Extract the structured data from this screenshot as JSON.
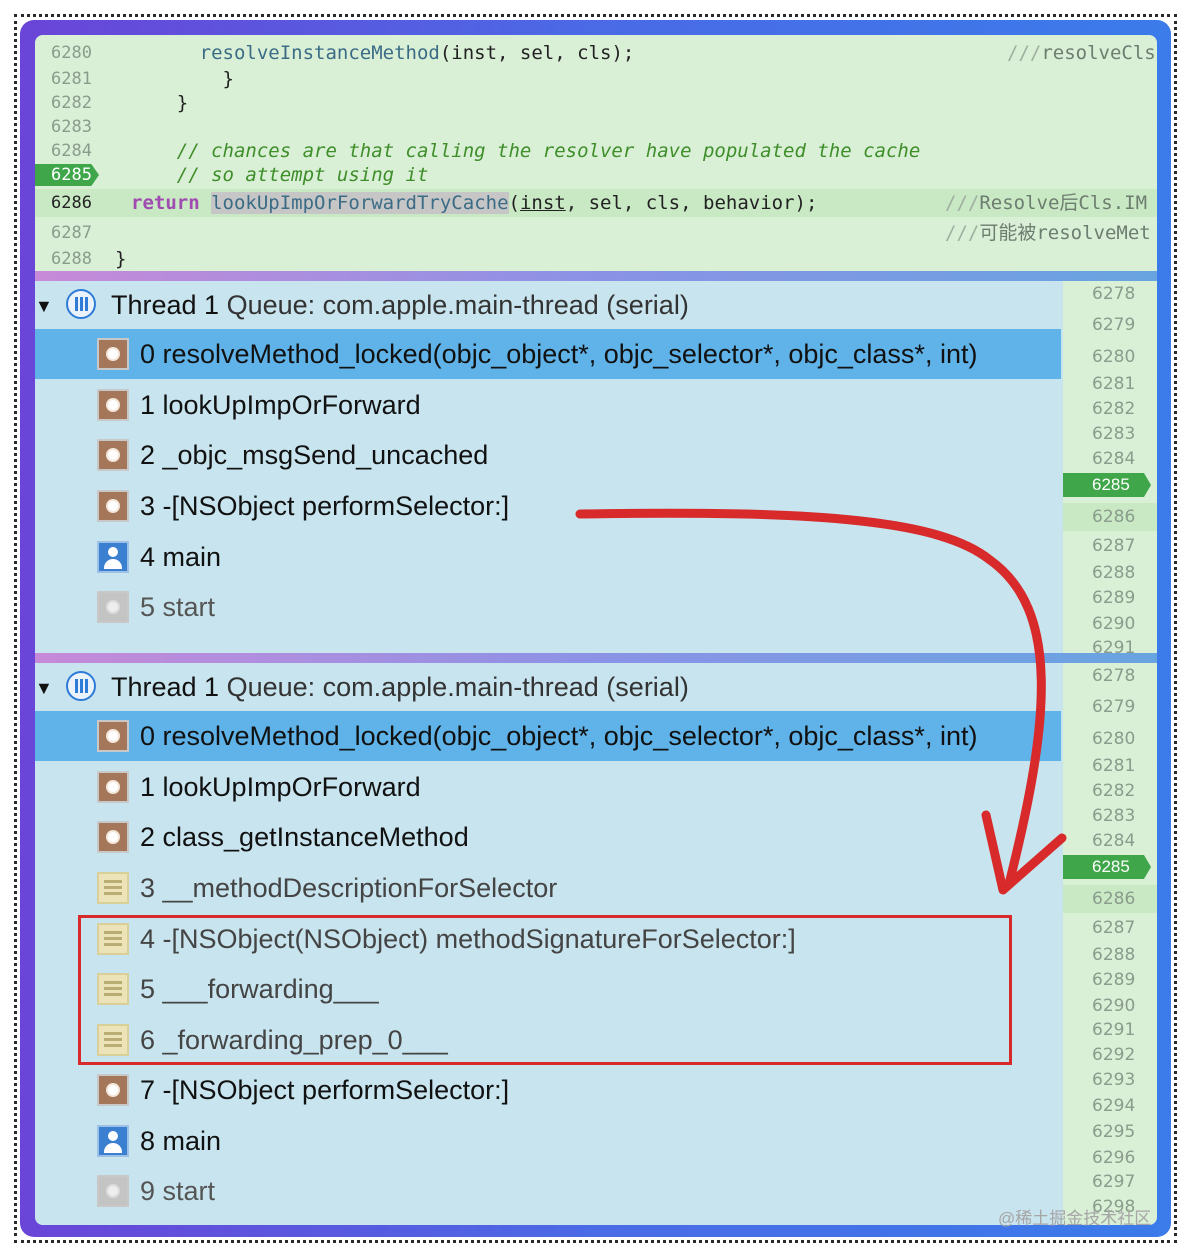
{
  "code": {
    "lines": [
      {
        "num": "6280",
        "pre": "      ",
        "fn": "resolveInstanceMethod",
        "post": "(inst, sel, cls);",
        "side_slashes": "///",
        "side": "resolveCls"
      },
      {
        "num": "6281",
        "text": "        }"
      },
      {
        "num": "6282",
        "text": "    }"
      },
      {
        "num": "6283",
        "text": ""
      },
      {
        "num": "6284",
        "comment": "    // chances are that calling the resolver have populated the cache"
      },
      {
        "num": "6285",
        "comment": "    // so attempt using it"
      },
      {
        "num": "6286",
        "kw": "return",
        "call": "lookUpImpOrForwardTryCache",
        "arg": "inst",
        "rest": ", sel, cls, behavior);",
        "side_slashes": "///",
        "side": "Resolve后Cls.IM"
      },
      {
        "num": "6287",
        "side_slashes": "///",
        "side": "可能被resolveMet"
      },
      {
        "num": "6288",
        "text": "}"
      }
    ]
  },
  "panel1": {
    "thread_title": "Thread 1",
    "queue": "Queue: com.apple.main-thread (serial)",
    "frames": [
      {
        "label": "0 resolveMethod_locked(objc_object*, objc_selector*, objc_class*, int)",
        "icon": "gear-icon"
      },
      {
        "label": "1 lookUpImpOrForward",
        "icon": "gear-icon"
      },
      {
        "label": "2 _objc_msgSend_uncached",
        "icon": "gear-icon"
      },
      {
        "label": "3 -[NSObject performSelector:]",
        "icon": "gear-icon"
      },
      {
        "label": "4 main",
        "icon": "user-icon"
      },
      {
        "label": "5 start",
        "icon": "gear-icon"
      }
    ],
    "gutter": [
      "6278",
      "6279",
      "6280",
      "6281",
      "6282",
      "6283",
      "6284",
      "6285",
      "6286",
      "6287",
      "6288",
      "6289",
      "6290",
      "6291"
    ]
  },
  "panel2": {
    "thread_title": "Thread 1",
    "queue": "Queue: com.apple.main-thread (serial)",
    "frames": [
      {
        "label": "0 resolveMethod_locked(objc_object*, objc_selector*, objc_class*, int)",
        "icon": "gear-icon"
      },
      {
        "label": "1 lookUpImpOrForward",
        "icon": "gear-icon"
      },
      {
        "label": "2 class_getInstanceMethod",
        "icon": "gear-icon"
      },
      {
        "label": "3 __methodDescriptionForSelector",
        "icon": "list-icon"
      },
      {
        "label": "4 -[NSObject(NSObject) methodSignatureForSelector:]",
        "icon": "list-icon"
      },
      {
        "label": "5 ___forwarding___",
        "icon": "list-icon"
      },
      {
        "label": "6 _forwarding_prep_0___",
        "icon": "list-icon"
      },
      {
        "label": "7 -[NSObject performSelector:]",
        "icon": "gear-icon"
      },
      {
        "label": "8 main",
        "icon": "user-icon"
      },
      {
        "label": "9 start",
        "icon": "gear-icon"
      }
    ],
    "gutter": [
      "6278",
      "6279",
      "6280",
      "6281",
      "6282",
      "6283",
      "6284",
      "6285",
      "6286",
      "6287",
      "6288",
      "6289",
      "6290",
      "6291",
      "6292",
      "6293",
      "6294",
      "6295",
      "6296",
      "6297",
      "6298"
    ]
  },
  "colors": {
    "annotation_red": "#d82a2a",
    "selection_blue": "#5fb3e8",
    "line_badge_green": "#3fa64a"
  },
  "watermark": "@稀土掘金技术社区"
}
